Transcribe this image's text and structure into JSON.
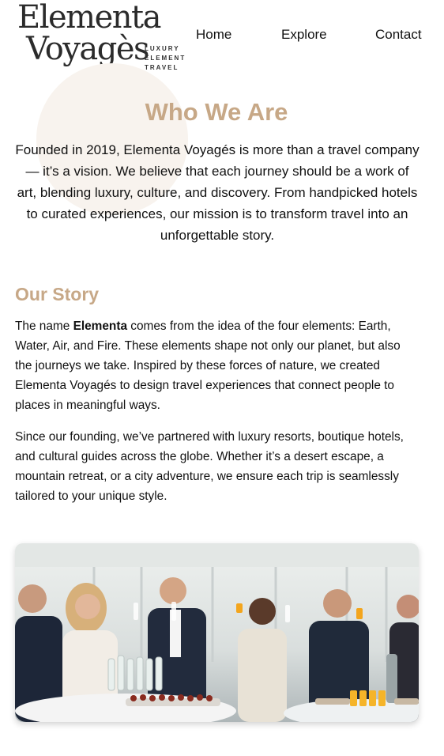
{
  "brand": {
    "name_line1": "Elementa",
    "name_line2": "Voyagès",
    "tagline_1": "LUXURY",
    "tagline_2": "ELEMENT",
    "tagline_3": "TRAVEL"
  },
  "nav": {
    "home": "Home",
    "explore": "Explore",
    "contact": "Contact"
  },
  "who": {
    "title": "Who We Are",
    "text": "Founded in 2019, Elementa Voyagés is more than a travel company — it’s a vision. We believe that each journey should be a work of art, blending luxury, culture, and discovery. From handpicked hotels to curated experiences, our mission is to transform travel into an unforgettable story."
  },
  "story": {
    "title": "Our Story",
    "para1_lead": "The name ",
    "para1_bold": "Elementa",
    "para1_rest": " comes from the idea of the four elements: Earth, Water, Air, and Fire. These elements shape not only our planet, but also the journeys we take. Inspired by these forces of nature, we created Elementa Voyagés to design travel experiences that connect people to places in meaningful ways.",
    "para2": "Since our founding, we’ve partnered with luxury resorts, boutique hotels, and cultural guides across the globe. Whether it’s a desert escape, a mountain retreat, or a city adventure, we ensure each trip is seamlessly tailored to your unique style."
  },
  "colors": {
    "accent": "#c7a887",
    "circle": "#f8f3ee",
    "text": "#111111"
  }
}
